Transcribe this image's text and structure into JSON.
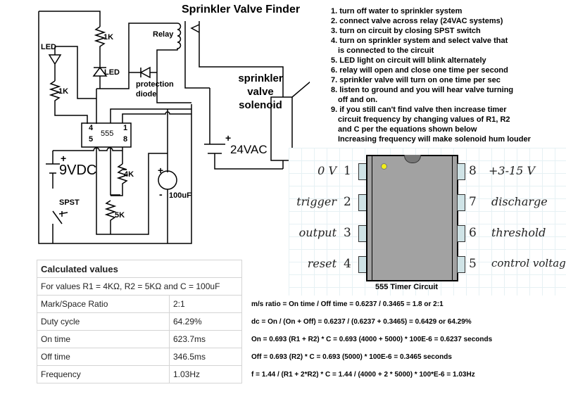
{
  "title": "Sprinkler Valve Finder",
  "instructions": [
    "1. turn off water to sprinkler system",
    "2. connect valve across relay (24VAC systems)",
    "3. turn on circuit by closing SPST switch",
    "4. turn on sprinkler system and select valve that",
    "is connected to the circuit",
    "5. LED light on circuit will blink alternately",
    "6. relay will open and close one time per second",
    "7. sprinkler valve will turn on one time per sec",
    "8. listen to ground and you will hear valve turning",
    "off and on.",
    "9. if you still can't find valve then increase timer",
    "circuit frequency by changing values of R1, R2",
    "and C per the equations shown below",
    "Increasing frequency will make solenoid hum louder"
  ],
  "schematic": {
    "labels": {
      "led_left": "LED",
      "led_right": "LED",
      "r_top": "1K",
      "r_left": "1K",
      "relay": "Relay",
      "protection_diode_1": "protection",
      "protection_diode_2": "diode",
      "ic": "555",
      "ic_pin4": "4",
      "ic_pin5": "5",
      "ic_pin1": "1",
      "ic_pin8": "8",
      "battery_plus": "+",
      "battery": "9VDC",
      "switch": "SPST",
      "r1": "4K",
      "r2": "5K",
      "cap_plus": "+",
      "cap_minus": "-",
      "cap": "100uF",
      "supply_plus": "+",
      "supply": "24VAC",
      "solenoid_1": "sprinkler",
      "solenoid_2": "valve",
      "solenoid_3": "solenoid"
    }
  },
  "pinout": {
    "caption": "555 Timer Circuit",
    "left_pins": [
      {
        "num": "1",
        "name": "0 V"
      },
      {
        "num": "2",
        "name": "trigger"
      },
      {
        "num": "3",
        "name": "output"
      },
      {
        "num": "4",
        "name": "reset"
      }
    ],
    "right_pins": [
      {
        "num": "8",
        "name": "+3-15 V"
      },
      {
        "num": "7",
        "name": "discharge"
      },
      {
        "num": "6",
        "name": "threshold"
      },
      {
        "num": "5",
        "name": "control voltage"
      }
    ],
    "colors": {
      "body": "#a2a2a2",
      "legs": "#cfe3e6",
      "dot": "#f2ef1a"
    }
  },
  "calc_table": {
    "header": "Calculated values",
    "subheader": "For values R1 = 4KΩ, R2 = 5KΩ and C = 100uF",
    "rows": [
      {
        "label": "Mark/Space Ratio",
        "value": "2:1"
      },
      {
        "label": "Duty cycle",
        "value": "64.29%"
      },
      {
        "label": "On time",
        "value": "623.7ms"
      },
      {
        "label": "Off time",
        "value": "346.5ms"
      },
      {
        "label": "Frequency",
        "value": "1.03Hz"
      }
    ]
  },
  "equations": [
    "m/s ratio =   On time / Off time = 0.6237 / 0.3465 = 1.8 or 2:1",
    "dc =  On / (On + Off)  =   0.6237 / (0.6237 + 0.3465) = 0.6429 or 64.29%",
    "On = 0.693 (R1 + R2) * C  =   0.693 (4000 + 5000) * 100E-6 = 0.6237 seconds",
    "Off = 0.693 (R2) * C  =  0.693 (5000) * 100E-6 = 0.3465 seconds",
    "f =  1.44 / (R1 + 2*R2) * C =  1.44 / (4000 + 2 * 5000) * 100*E-6  = 1.03Hz"
  ]
}
